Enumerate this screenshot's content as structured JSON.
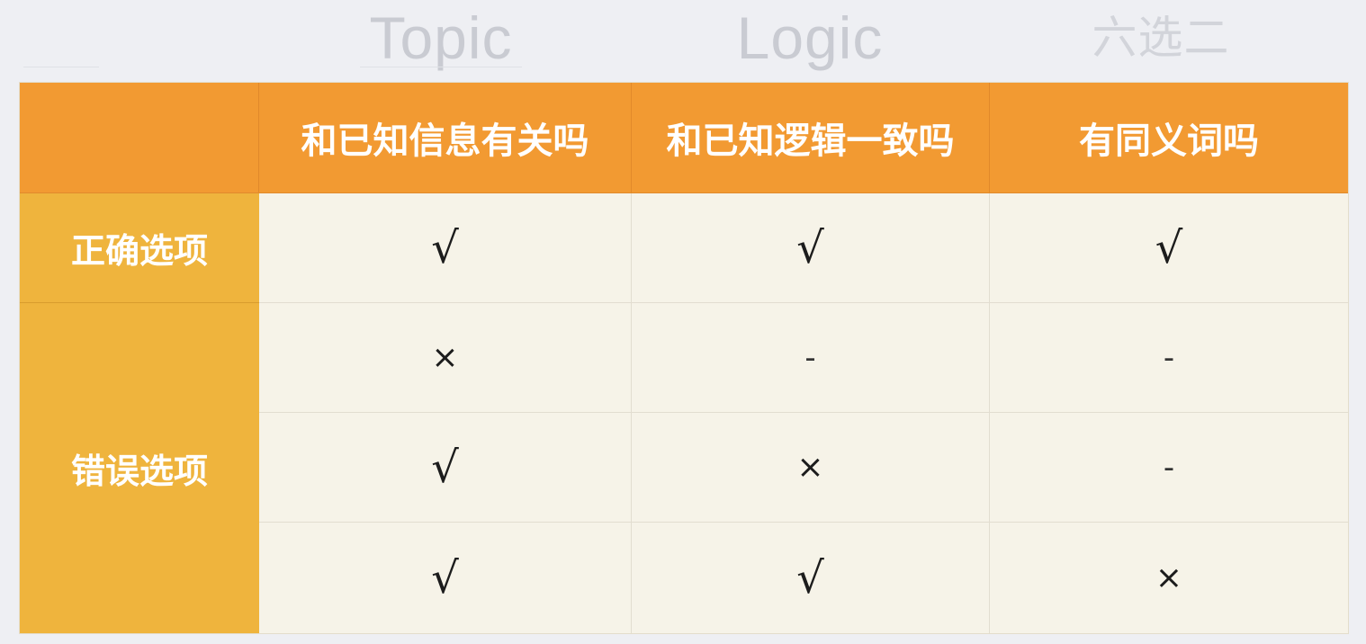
{
  "top_labels": [
    "Topic",
    "Logic",
    "六选二"
  ],
  "table": {
    "corner": "",
    "columns": [
      "和已知信息有关吗",
      "和已知逻辑一致吗",
      "有同义词吗"
    ],
    "groups": {
      "correct_label": "正确选项",
      "wrong_label": "错误选项"
    },
    "rows": [
      [
        "√",
        "√",
        "√"
      ],
      [
        "×",
        "-",
        "-"
      ],
      [
        "√",
        "×",
        "-"
      ],
      [
        "√",
        "√",
        "×"
      ]
    ]
  },
  "colors": {
    "header_bg": "#f29a32",
    "row_header_bg": "#efb43d",
    "cell_bg": "#f6f3e8",
    "page_bg": "#eeeff3"
  }
}
